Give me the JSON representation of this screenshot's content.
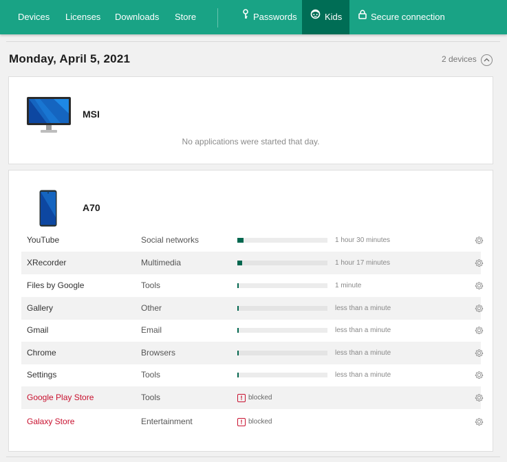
{
  "nav": {
    "items": [
      {
        "label": "Devices"
      },
      {
        "label": "Licenses"
      },
      {
        "label": "Downloads"
      },
      {
        "label": "Store"
      },
      {
        "label": "Passwords",
        "icon": "key-icon"
      },
      {
        "label": "Kids",
        "icon": "kids-icon",
        "active": true
      },
      {
        "label": "Secure connection",
        "icon": "lock-icon"
      }
    ]
  },
  "colors": {
    "header_bg": "#19a385",
    "header_active": "#006d55",
    "bar_fill": "#00674f",
    "blocked_red": "#c8102e"
  },
  "date_heading": "Monday, April 5, 2021",
  "device_count": "2 devices",
  "devices": [
    {
      "name": "MSI",
      "icon": "monitor-icon",
      "empty_message": "No applications were started that day."
    },
    {
      "name": "A70",
      "icon": "phone-icon",
      "apps": [
        {
          "name": "YouTube",
          "category": "Social networks",
          "time": "1 hour 30 minutes",
          "usage_fraction": 0.07,
          "blocked": false
        },
        {
          "name": "XRecorder",
          "category": "Multimedia",
          "time": "1 hour 17 minutes",
          "usage_fraction": 0.055,
          "blocked": false
        },
        {
          "name": "Files by Google",
          "category": "Tools",
          "time": "1 minute",
          "usage_fraction": 0.01,
          "blocked": false
        },
        {
          "name": "Gallery",
          "category": "Other",
          "time": "less than a minute",
          "usage_fraction": 0.01,
          "blocked": false
        },
        {
          "name": "Gmail",
          "category": "Email",
          "time": "less than a minute",
          "usage_fraction": 0.01,
          "blocked": false
        },
        {
          "name": "Chrome",
          "category": "Browsers",
          "time": "less than a minute",
          "usage_fraction": 0.01,
          "blocked": false
        },
        {
          "name": "Settings",
          "category": "Tools",
          "time": "less than a minute",
          "usage_fraction": 0.01,
          "blocked": false
        },
        {
          "name": "Google Play Store",
          "category": "Tools",
          "blocked": true,
          "blocked_label": "blocked"
        },
        {
          "name": "Galaxy Store",
          "category": "Entertainment",
          "blocked": true,
          "blocked_label": "blocked"
        }
      ]
    }
  ]
}
